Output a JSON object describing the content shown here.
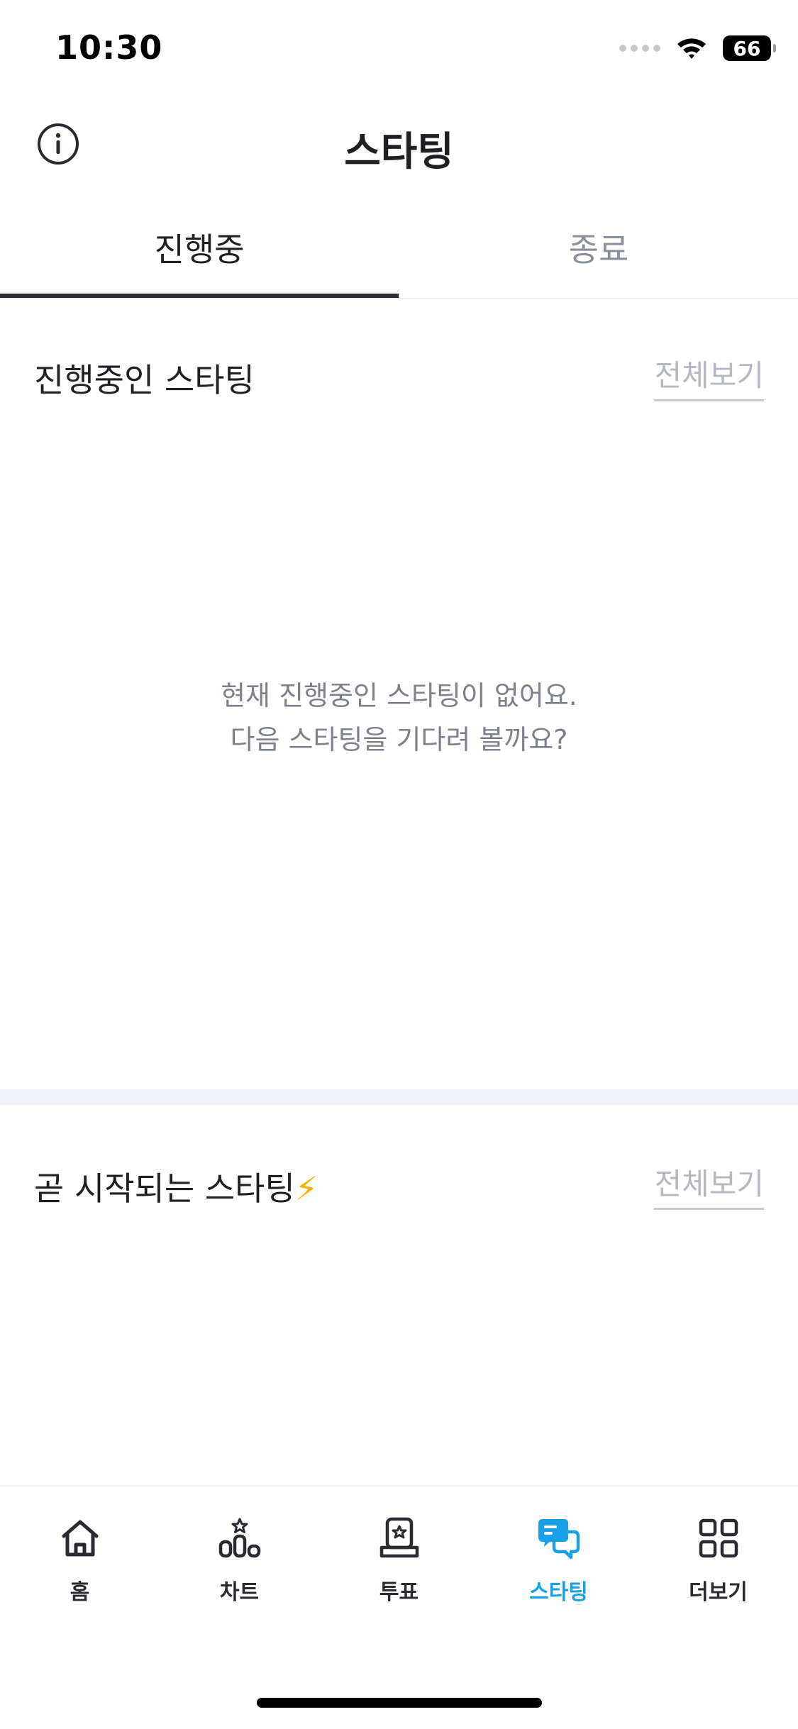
{
  "status_bar": {
    "time": "10:30",
    "battery": "66"
  },
  "header": {
    "title": "스타팅"
  },
  "tabs": [
    {
      "label": "진행중",
      "active": true
    },
    {
      "label": "종료",
      "active": false
    }
  ],
  "ongoing": {
    "title": "진행중인 스타팅",
    "see_all": "전체보기",
    "empty_line1": "현재 진행중인 스타팅이 없어요.",
    "empty_line2": "다음 스타팅을 기다려 볼까요?"
  },
  "upcoming": {
    "title": "곧 시작되는 스타팅",
    "emoji": "⚡",
    "see_all": "전체보기"
  },
  "bottom_nav": [
    {
      "label": "홈",
      "icon": "home-icon",
      "active": false
    },
    {
      "label": "차트",
      "icon": "chart-icon",
      "active": false
    },
    {
      "label": "투표",
      "icon": "vote-icon",
      "active": false
    },
    {
      "label": "스타팅",
      "icon": "chat-bubbles-icon",
      "active": true
    },
    {
      "label": "더보기",
      "icon": "grid-icon",
      "active": false
    }
  ],
  "colors": {
    "accent": "#1aa0e6",
    "text": "#1f1f24",
    "muted": "#8b8f9a",
    "divider": "#f1f2f8"
  }
}
